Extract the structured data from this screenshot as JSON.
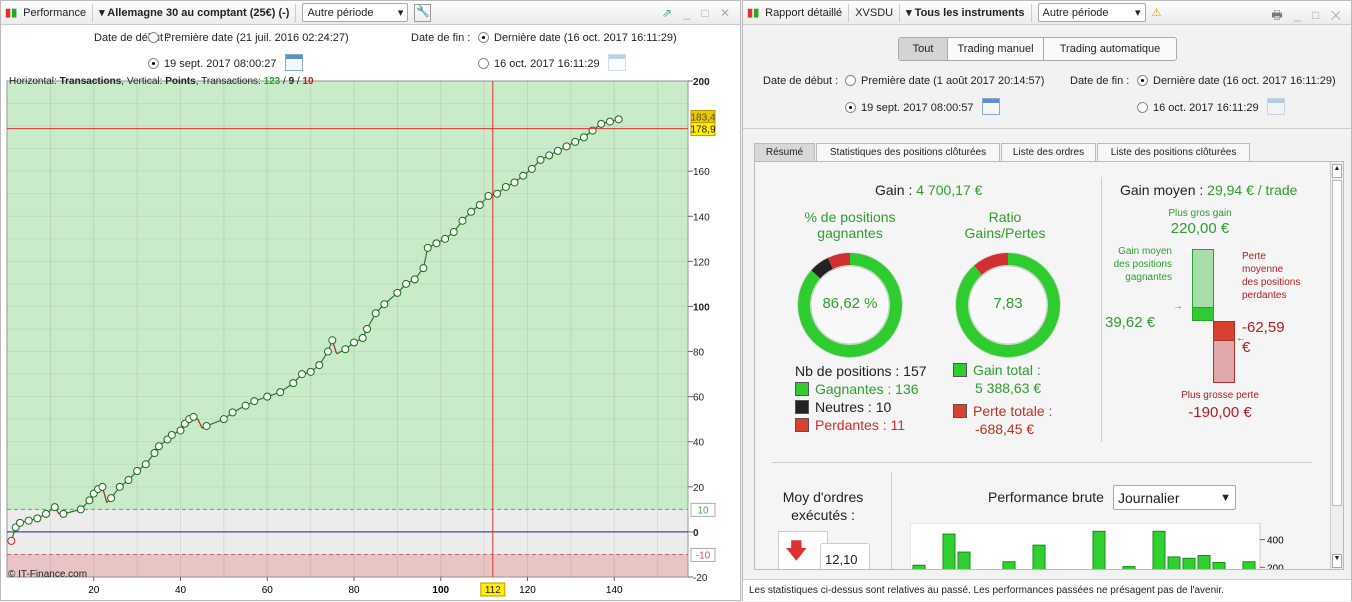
{
  "left": {
    "toolbar": {
      "title": "Performance",
      "instrument": "Allemagne 30 au comptant (25€) (-)",
      "period": "Autre période"
    },
    "dates": {
      "start_label": "Date de début :",
      "start_first": "Première date (21 juil. 2016 02:24:27)",
      "start_custom": "19 sept. 2017 08:00:27",
      "end_label": "Date de fin :",
      "end_last": "Dernière date (16 oct. 2017 16:11:29)",
      "end_custom": "16 oct. 2017 16:11:29"
    },
    "chart_info": {
      "prefix": "Horizontal: ",
      "h": "Transactions",
      "mid": ", Vertical: ",
      "v": "Points",
      "mid2": ", Transactions: ",
      "win": "123",
      "sep1": " / ",
      "neutral": "9",
      "sep2": " / ",
      "loss": "10"
    },
    "watermark": "© IT-Finance.com",
    "crosshair": {
      "x_label": "112",
      "y_label": "178,9",
      "last_label": "183,4"
    },
    "band_labels": {
      "upper": "10",
      "lower": "-10"
    }
  },
  "chart_data": {
    "type": "line",
    "xlim": [
      0,
      157
    ],
    "ylim": [
      -20,
      200
    ],
    "x_ticks": [
      20,
      40,
      60,
      80,
      100,
      120,
      140
    ],
    "y_ticks": [
      200,
      160,
      140,
      120,
      100,
      80,
      60,
      40,
      20,
      0,
      -20
    ],
    "bands": {
      "gain_above": 10,
      "loss_below": -10
    },
    "grid": true,
    "x": [
      1,
      2,
      3,
      5,
      7,
      9,
      11,
      12,
      13,
      17,
      19,
      20,
      21,
      22,
      23,
      24,
      26,
      28,
      30,
      32,
      34,
      35,
      37,
      38,
      40,
      41,
      42,
      43,
      44,
      45,
      46,
      50,
      52,
      55,
      57,
      60,
      63,
      66,
      68,
      70,
      72,
      74,
      75,
      76,
      78,
      80,
      82,
      83,
      85,
      87,
      90,
      92,
      94,
      96,
      97,
      99,
      101,
      103,
      105,
      107,
      109,
      111,
      113,
      115,
      117,
      119,
      121,
      123,
      125,
      127,
      129,
      131,
      133,
      135,
      137,
      139,
      141
    ],
    "y": [
      -4,
      2,
      4,
      5,
      6,
      8,
      11,
      8,
      8,
      10,
      14,
      17,
      19,
      20,
      13,
      15,
      20,
      23,
      27,
      30,
      35,
      38,
      41,
      43,
      45,
      48,
      50,
      51,
      50,
      46,
      47,
      50,
      53,
      56,
      58,
      60,
      62,
      66,
      70,
      71,
      74,
      80,
      85,
      79,
      81,
      84,
      86,
      90,
      97,
      101,
      106,
      110,
      112,
      117,
      126,
      128,
      130,
      133,
      138,
      142,
      145,
      149,
      150,
      153,
      155,
      158,
      161,
      165,
      167,
      169,
      171,
      173,
      175,
      178,
      181,
      182,
      183
    ]
  },
  "right": {
    "toolbar": {
      "title": "Rapport détaillé",
      "account": "XVSDU",
      "instruments": "Tous les instruments",
      "period": "Autre période"
    },
    "segments": [
      "Tout",
      "Trading manuel",
      "Trading automatique"
    ],
    "dates": {
      "start_label": "Date de début :",
      "start_first": "Première date (1 août 2017 20:14:57)",
      "start_custom": "19 sept. 2017 08:00:57",
      "end_label": "Date de fin :",
      "end_last": "Dernière date (16 oct. 2017 16:11:29)",
      "end_custom": "16 oct. 2017 16:11:29"
    },
    "tabs": [
      "Résumé",
      "Statistiques des positions clôturées",
      "Liste des ordres",
      "Liste des positions clôturées"
    ],
    "summary": {
      "gain_label": "Gain : ",
      "gain_value": "4 700,17 €",
      "win_pct_title": "% de positions gagnantes",
      "win_pct": "86,62 %",
      "win_fraction": 0.8662,
      "neutral_fraction": 0.0637,
      "loss_fraction": 0.0701,
      "ratio_title": "Ratio Gains/Pertes",
      "ratio": "7,83",
      "nb_positions": "Nb de positions : 157",
      "winners": "Gagnantes : 136",
      "neutrals": "Neutres : 10",
      "losers": "Perdantes : 11",
      "gain_total_label": "Gain total :",
      "gain_total": "5 388,63 €",
      "loss_total_label": "Perte totale :",
      "loss_total": "-688,45 €",
      "avg_gain_label": "Gain moyen : ",
      "avg_gain": "29,94 € / trade",
      "max_gain_label": "Plus gros gain",
      "max_gain": "220,00 €",
      "avg_win_label": "Gain moyen des positions gagnantes",
      "avg_win": "39,62 €",
      "avg_loss_label": "Perte moyenne des positions perdantes",
      "avg_loss": "-62,59 €",
      "max_loss_label": "Plus grosse perte",
      "max_loss": "-190,00 €",
      "orders_label": "Moy d'ordres exécutés :",
      "orders_value": "12,10",
      "perf_label": "Performance brute",
      "perf_period": "Journalier",
      "perf_ticks": [
        "400",
        "200"
      ],
      "perf_bars": [
        215,
        120,
        440,
        310,
        0,
        105,
        240,
        0,
        360,
        0,
        175,
        0,
        460,
        165,
        205,
        0,
        460,
        275,
        265,
        285,
        235,
        0,
        240
      ]
    },
    "status": "Les statistiques ci-dessus sont relatives au passé. Les performances passées ne présagent pas de l'avenir."
  },
  "colors": {
    "green": "#2ecc2e",
    "red": "#d03030",
    "neutral": "#222222",
    "band_green": "#c9ebc9",
    "band_red": "#e8c4c4"
  }
}
